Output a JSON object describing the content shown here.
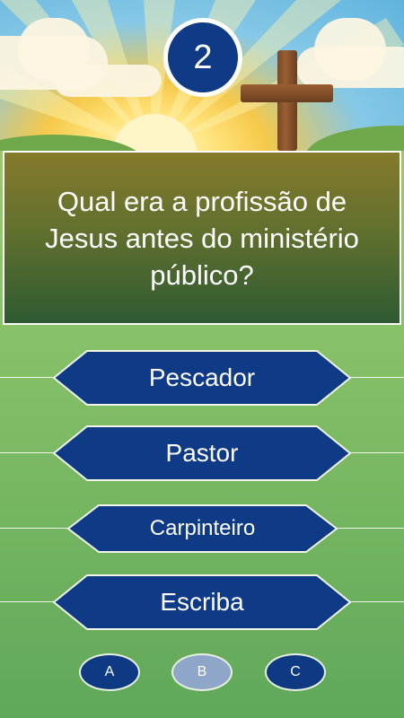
{
  "question_number": "2",
  "question": "Qual era a profissão de Jesus antes do ministério público?",
  "answers": [
    {
      "label": "Pescador"
    },
    {
      "label": "Pastor"
    },
    {
      "label": "Carpinteiro"
    },
    {
      "label": "Escriba"
    }
  ],
  "options": [
    {
      "label": "A",
      "selected": false
    },
    {
      "label": "B",
      "selected": true
    },
    {
      "label": "C",
      "selected": false
    }
  ],
  "colors": {
    "button_blue": "#0f3a86",
    "selected_option": "#8ea6c8"
  }
}
